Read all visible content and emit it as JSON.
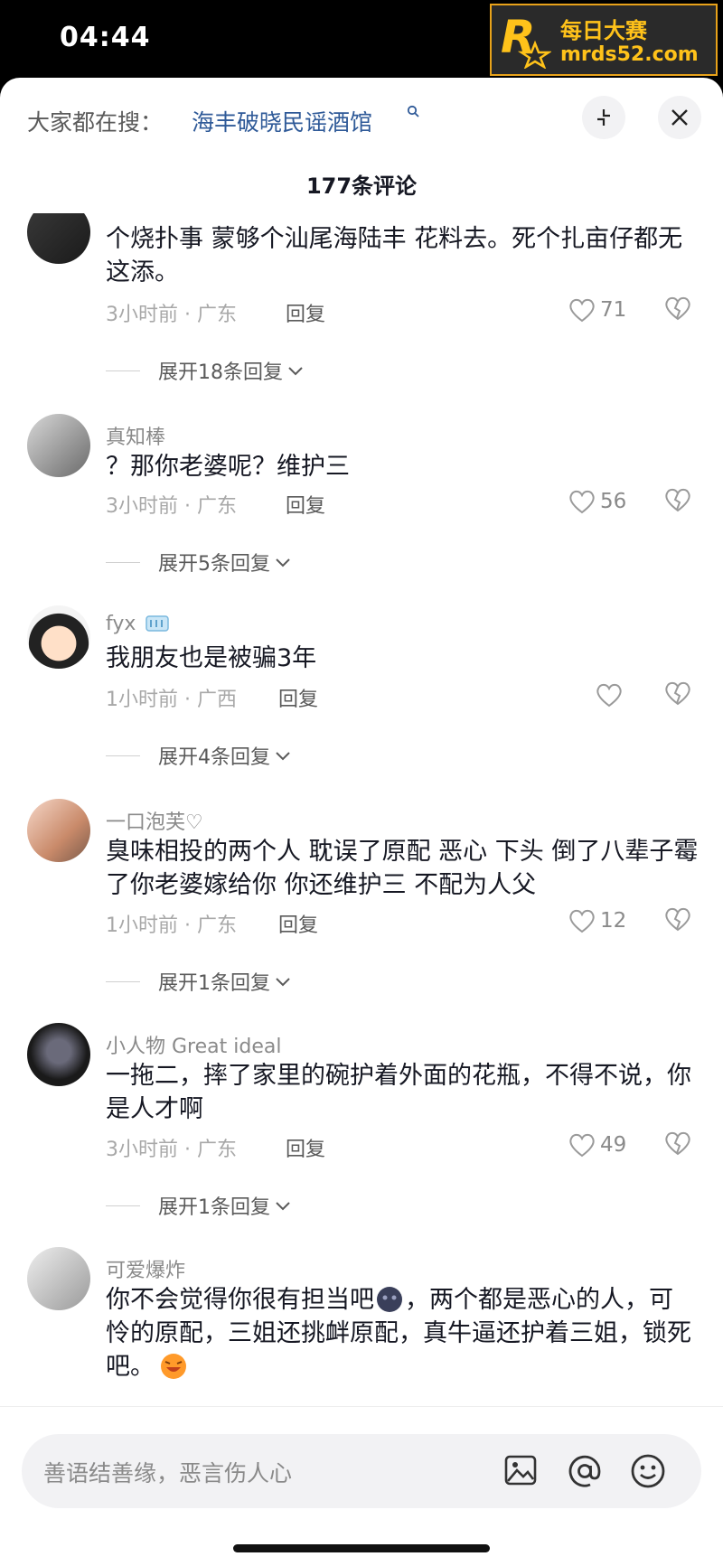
{
  "status_bar": {
    "time": "04:44"
  },
  "watermark": {
    "line1": "每日大赛",
    "line2": "mrds52.com",
    "logo": "R"
  },
  "search": {
    "prefix": "大家都在搜：",
    "term": "海丰破晓民谣酒馆"
  },
  "header": {
    "comment_count": "177条评论"
  },
  "comments": [
    {
      "username": "",
      "text": "个烧扑事 蒙够个汕尾海陆丰 花料去。死个扎亩仔都无这添。",
      "meta": "3小时前 · 广东",
      "reply": "回复",
      "likes": "71",
      "expand": "展开18条回复"
    },
    {
      "username": "真知棒",
      "text": "？那你老婆呢？维护三",
      "meta": "3小时前 · 广东",
      "reply": "回复",
      "likes": "56",
      "expand": "展开5条回复"
    },
    {
      "username": "fyx",
      "text": "我朋友也是被骗3年",
      "meta": "1小时前 · 广西",
      "reply": "回复",
      "likes": "",
      "expand": "展开4条回复"
    },
    {
      "username": "一口泡芙♡",
      "text": "臭味相投的两个人  耽误了原配  恶心 下头  倒了八辈子霉了你老婆嫁给你  你还维护三  不配为人父",
      "meta": "1小时前 · 广东",
      "reply": "回复",
      "likes": "12",
      "expand": "展开1条回复"
    },
    {
      "username": "小人物 Great ideal",
      "text": "一拖二，摔了家里的碗护着外面的花瓶，不得不说，你是人才啊",
      "meta": "3小时前 · 广东",
      "reply": "回复",
      "likes": "49",
      "expand": "展开1条回复"
    },
    {
      "username": "可爱爆炸",
      "text": "你不会觉得你很有担当吧",
      "text2": "，两个都是恶心的人，可怜的原配，三姐还挑衅原配，真牛逼还护着三姐，锁死吧。",
      "meta": "",
      "reply": "",
      "likes": "",
      "expand": ""
    }
  ],
  "composer": {
    "placeholder": "善语结善缘，恶言伤人心"
  }
}
